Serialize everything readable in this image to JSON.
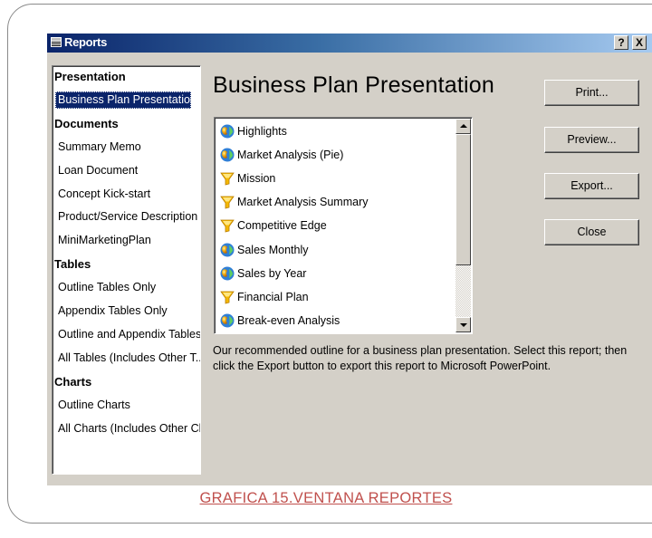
{
  "window": {
    "title": "Reports",
    "help_label": "?",
    "close_label": "X"
  },
  "sidebar": {
    "rows": [
      {
        "label": "Presentation",
        "kind": "category"
      },
      {
        "label": "Business Plan Presentation",
        "kind": "item",
        "selected": true
      },
      {
        "label": "Documents",
        "kind": "category"
      },
      {
        "label": "Summary Memo",
        "kind": "item"
      },
      {
        "label": "Loan Document",
        "kind": "item"
      },
      {
        "label": "Concept Kick-start",
        "kind": "item"
      },
      {
        "label": "Product/Service Description",
        "kind": "item"
      },
      {
        "label": "MiniMarketingPlan",
        "kind": "item"
      },
      {
        "label": "Tables",
        "kind": "category"
      },
      {
        "label": "Outline Tables Only",
        "kind": "item"
      },
      {
        "label": "Appendix Tables Only",
        "kind": "item"
      },
      {
        "label": "Outline and Appendix Tables",
        "kind": "item"
      },
      {
        "label": "All Tables (Includes Other T...",
        "kind": "item"
      },
      {
        "label": "Charts",
        "kind": "category"
      },
      {
        "label": "Outline Charts",
        "kind": "item"
      },
      {
        "label": "All Charts (Includes Other Ch...",
        "kind": "item"
      }
    ]
  },
  "main": {
    "heading": "Business Plan Presentation",
    "outline_items": [
      {
        "label": "Highlights",
        "icon": "globe-icon"
      },
      {
        "label": "Market Analysis (Pie)",
        "icon": "globe-icon"
      },
      {
        "label": "Mission",
        "icon": "funnel-icon"
      },
      {
        "label": "Market Analysis Summary",
        "icon": "funnel-icon"
      },
      {
        "label": "Competitive Edge",
        "icon": "funnel-icon"
      },
      {
        "label": "Sales Monthly",
        "icon": "globe-icon"
      },
      {
        "label": "Sales by Year",
        "icon": "globe-icon"
      },
      {
        "label": "Financial Plan",
        "icon": "funnel-icon"
      },
      {
        "label": "Break-even Analysis",
        "icon": "globe-icon"
      }
    ],
    "description": "Our recommended outline for a business plan presentation. Select this report; then click the Export button to export this report to Microsoft PowerPoint."
  },
  "buttons": {
    "print": "Print...",
    "preview": "Preview...",
    "export": "Export...",
    "close": "Close"
  },
  "caption": "GRAFICA 15.VENTANA REPORTES",
  "colors": {
    "titlebar_start": "#0a246a",
    "titlebar_end": "#a6caf0",
    "selection": "#0a246a",
    "caption": "#c0504d",
    "dialog_face": "#d4d0c8"
  }
}
